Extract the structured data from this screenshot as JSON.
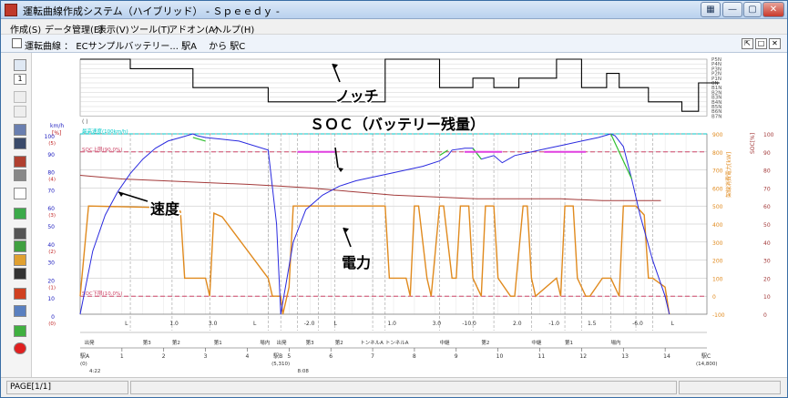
{
  "window": {
    "title": "運転曲線作成システム（ハイブリッド） - Ｓｐｅｅｄｙ -"
  },
  "menu": [
    "作成(S)",
    "データ管理(E)",
    "表示(V)",
    "ツール(T)",
    "アドオン(A)",
    "ヘルプ(H)"
  ],
  "document": {
    "title": "運転曲線 ：  ECサンプルバッテリー... 駅A　 から 駅C"
  },
  "toolbar": {
    "page_input": "1"
  },
  "status": {
    "page": "PAGE[1/1]"
  },
  "annotations": {
    "notch": "ノッチ",
    "soc": "ＳＯＣ（バッテリー残量）",
    "speed": "速度",
    "power": "電力"
  },
  "colors": {
    "speed": "#2a2adf",
    "soc": "#a33a3a",
    "power": "#e08a1e",
    "ceiling": "#00c8c8",
    "limit_line": "#cc4466",
    "magenta": "#e040e0",
    "green": "#30c030"
  },
  "chart_data": {
    "type": "line",
    "notch_labels": [
      "P5N",
      "P4N",
      "P3N",
      "P2N",
      "P1N",
      "0N",
      "B1N",
      "B2N",
      "B3N",
      "B4N",
      "B5N",
      "B6N",
      "B7N"
    ],
    "notch_series": {
      "name": "",
      "x": [
        0,
        12,
        12,
        27,
        27,
        45,
        45,
        73,
        73,
        86,
        86,
        94,
        94,
        99,
        99,
        105,
        105,
        114,
        114,
        120,
        120,
        126,
        126,
        129,
        129,
        136,
        136,
        144,
        144,
        148,
        148,
        153
      ],
      "values": [
        0,
        0,
        2,
        2,
        6,
        6,
        9,
        9,
        0,
        0,
        6,
        6,
        4,
        4,
        6,
        6,
        4,
        4,
        0,
        0,
        6,
        6,
        3,
        3,
        6,
        6,
        9,
        9,
        11,
        11,
        5,
        5
      ]
    },
    "speed_axis": {
      "label": "km/h",
      "sublabel": "[%]",
      "ticks": [
        100,
        90,
        80,
        70,
        60,
        50,
        40,
        30,
        20,
        10,
        0
      ],
      "sub_ticks": [
        "(5)",
        "(4)",
        "(3)",
        "(2)",
        "(1)",
        "(0)"
      ]
    },
    "power_axis": {
      "label": "架線消費電力[kW]",
      "ticks": [
        900,
        800,
        700,
        600,
        500,
        400,
        300,
        200,
        100,
        0,
        -100
      ]
    },
    "soc_axis": {
      "label": "SOC[%]",
      "ticks": [
        100,
        90,
        80,
        70,
        60,
        50,
        40,
        30,
        20,
        10,
        0
      ]
    },
    "soc_upper_label": "SOC上限(90.0%)",
    "soc_lower_label": "SOC下限(10.0%)",
    "ceiling_label": "最高速度(100km/h)",
    "series": [
      {
        "name": "速度",
        "x": [
          0,
          3,
          6,
          9,
          12,
          15,
          18,
          21,
          24,
          27,
          28,
          30,
          34,
          38,
          45,
          47,
          48,
          51,
          54,
          58,
          62,
          66,
          70,
          74,
          78,
          82,
          86,
          88,
          89,
          92,
          94,
          96,
          99,
          101,
          104,
          108,
          112,
          116,
          120,
          124,
          127,
          128,
          130,
          132,
          134,
          137,
          140,
          141
        ],
        "values": [
          0,
          35,
          55,
          68,
          78,
          86,
          92,
          96,
          98,
          100,
          99,
          98,
          97,
          96,
          91,
          50,
          0,
          40,
          58,
          66,
          71,
          74,
          76,
          78,
          80,
          82,
          85,
          88,
          91,
          92,
          92,
          86,
          88,
          84,
          88,
          90,
          92,
          94,
          96,
          98,
          100,
          99,
          93,
          75,
          55,
          30,
          10,
          0
        ]
      },
      {
        "name": "SOC",
        "x": [
          0,
          10,
          20,
          30,
          40,
          48,
          55,
          65,
          75,
          85,
          95,
          105,
          115,
          125,
          135,
          138,
          139
        ],
        "values": [
          77,
          75,
          74,
          73,
          72,
          71,
          70,
          68,
          66,
          65,
          64,
          64,
          64,
          63,
          63,
          63,
          63
        ]
      },
      {
        "name": "電力",
        "x": [
          0,
          2,
          22,
          24,
          25,
          26,
          28,
          30,
          31,
          32,
          34,
          45,
          46,
          48,
          48.5,
          50,
          51,
          60,
          70,
          72,
          73,
          74,
          75,
          78,
          79,
          80,
          81,
          83,
          84,
          86,
          87,
          89,
          90,
          91,
          93,
          94,
          96,
          97,
          99,
          100,
          103,
          104,
          106,
          107,
          108,
          109,
          114,
          115,
          116,
          118,
          119,
          121,
          122,
          125,
          127,
          129,
          130,
          131,
          133,
          135,
          136,
          137,
          140,
          141
        ],
        "values": [
          0,
          500,
          490,
          470,
          100,
          100,
          100,
          100,
          0,
          460,
          440,
          100,
          0,
          0,
          -100,
          50,
          500,
          500,
          500,
          500,
          500,
          100,
          100,
          100,
          0,
          500,
          500,
          100,
          0,
          500,
          500,
          100,
          100,
          500,
          500,
          100,
          0,
          500,
          500,
          100,
          0,
          0,
          500,
          500,
          100,
          0,
          100,
          0,
          500,
          500,
          100,
          0,
          0,
          100,
          100,
          0,
          500,
          500,
          500,
          450,
          100,
          100,
          50,
          -100
        ]
      }
    ],
    "segments": [
      "L",
      "1.0",
      "3.0",
      "L",
      "-2.0",
      "L",
      "1.0",
      "3.0",
      "-10.0",
      "2.0",
      "-1.0",
      "1.5",
      "-6.0",
      "L"
    ],
    "stations_top": [
      "出発",
      "第3",
      "第2",
      "第1",
      "場内",
      "出発",
      "第3",
      "第2",
      "トンネルA",
      "トンネルA",
      "中継",
      "第2",
      "中継",
      "第1",
      "場内"
    ],
    "km_marks": [
      "1",
      "2",
      "3",
      "4",
      "5",
      "6",
      "7",
      "8",
      "9",
      "10",
      "11",
      "12",
      "13",
      "14"
    ],
    "station_a": {
      "name": "駅A",
      "km": "(0)",
      "time": "4:22"
    },
    "station_b": {
      "name": "駅B",
      "km": "(5,310)",
      "time": "8:08"
    },
    "station_c": {
      "name": "駅C",
      "km": "(14,800)"
    }
  }
}
